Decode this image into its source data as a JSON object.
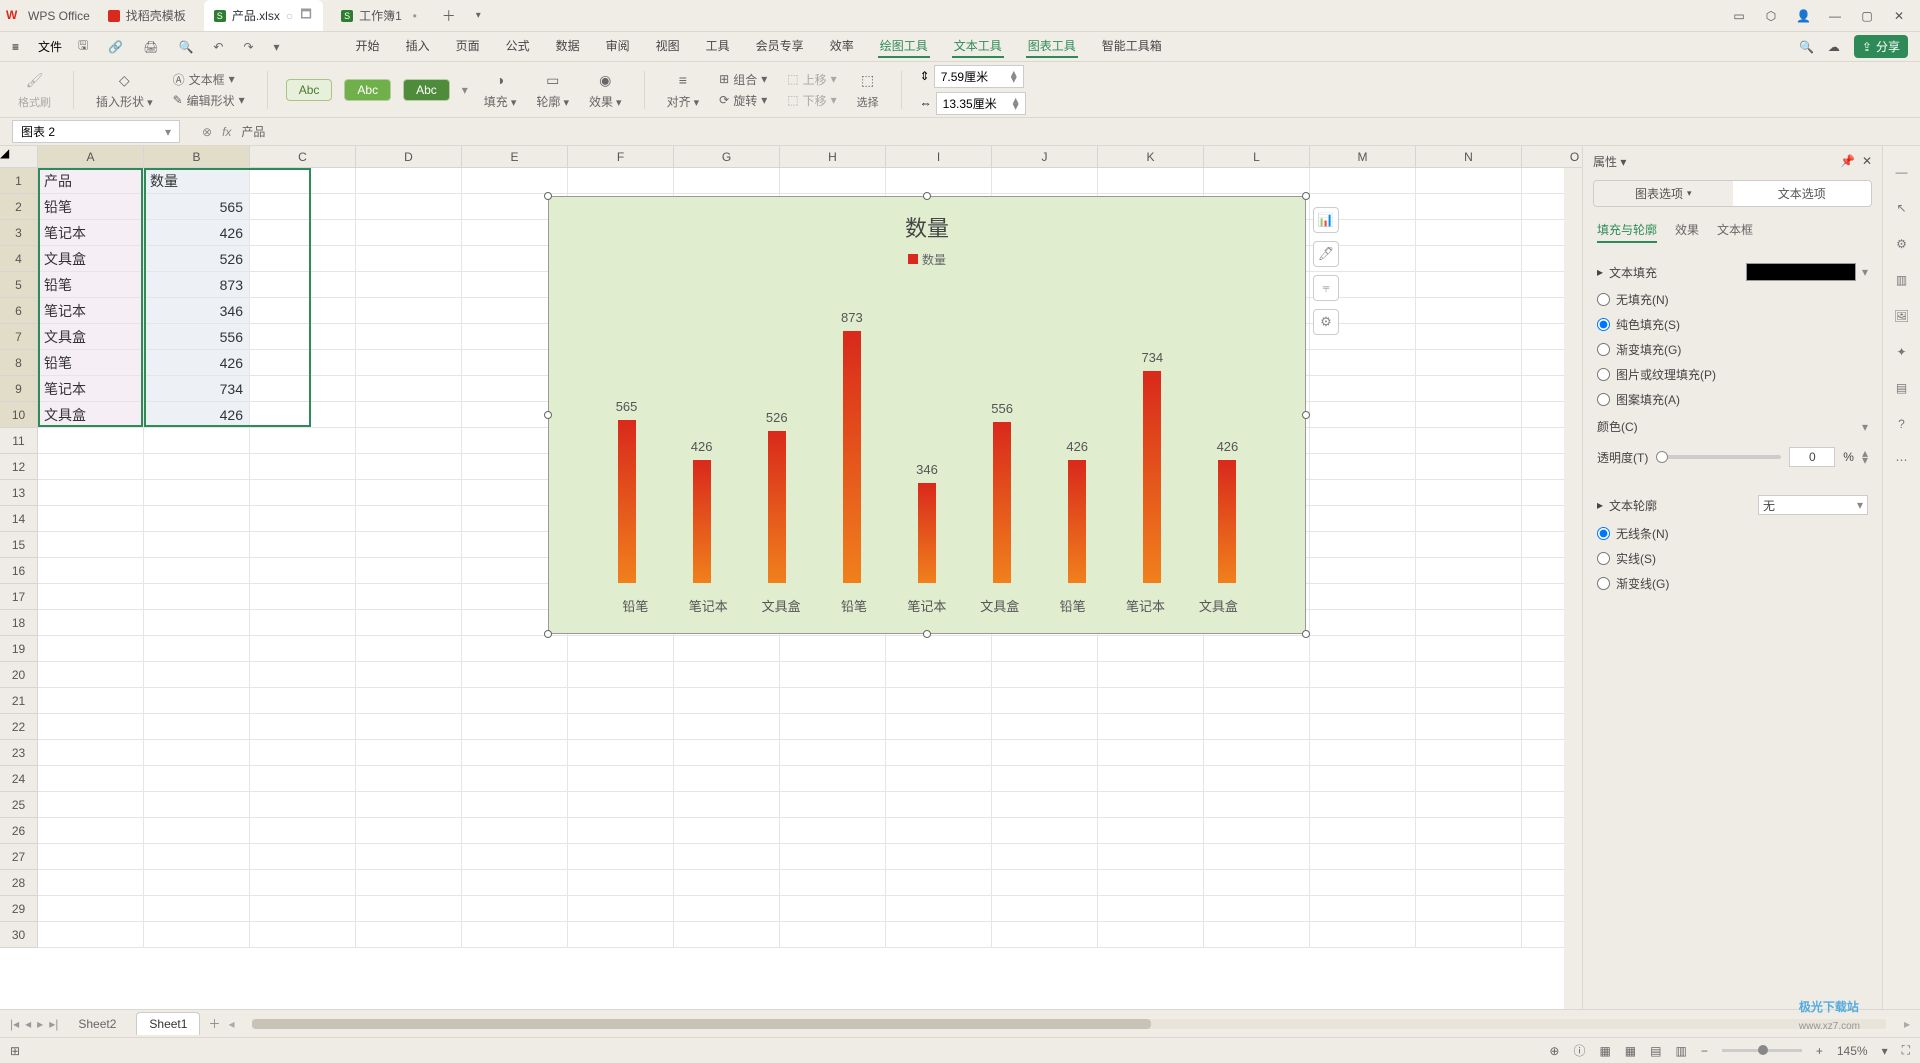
{
  "app_name": "WPS Office",
  "tabs": [
    {
      "icon_cls": "doc",
      "label": "找稻壳模板"
    },
    {
      "icon_cls": "xls",
      "label": "产品.xlsx",
      "active": true
    },
    {
      "icon_cls": "xls",
      "label": "工作簿1"
    }
  ],
  "file_menu": "文件",
  "main_menu": [
    "开始",
    "插入",
    "页面",
    "公式",
    "数据",
    "审阅",
    "视图",
    "工具",
    "会员专享",
    "效率",
    "绘图工具",
    "文本工具",
    "图表工具",
    "智能工具箱"
  ],
  "green_menus": [
    "绘图工具",
    "文本工具",
    "图表工具"
  ],
  "share_btn": "分享",
  "ribbon": {
    "format_painter": "格式刷",
    "insert_shape": "插入形状",
    "edit_shape": "编辑形状",
    "text_box": "文本框",
    "fill": "填充",
    "outline": "轮廓",
    "effects": "效果",
    "align": "对齐",
    "group": "组合",
    "move_up": "上移",
    "rotate": "旋转",
    "move_down": "下移",
    "select": "选择",
    "height": "7.59厘米",
    "width": "13.35厘米",
    "abc": "Abc"
  },
  "name_box": "图表 2",
  "fx_text": "产品",
  "columns": [
    "A",
    "B",
    "C",
    "D",
    "E",
    "F",
    "G",
    "H",
    "I",
    "J",
    "K",
    "L",
    "M",
    "N",
    "O"
  ],
  "sel_cols": [
    "A",
    "B"
  ],
  "sel_rows": 10,
  "table": {
    "headers": [
      "产品",
      "数量"
    ],
    "rows": [
      [
        "铅笔",
        565
      ],
      [
        "笔记本",
        426
      ],
      [
        "文具盒",
        526
      ],
      [
        "铅笔",
        873
      ],
      [
        "笔记本",
        346
      ],
      [
        "文具盒",
        556
      ],
      [
        "铅笔",
        426
      ],
      [
        "笔记本",
        734
      ],
      [
        "文具盒",
        426
      ]
    ]
  },
  "chart_data": {
    "type": "bar",
    "title": "数量",
    "legend": "数量",
    "categories": [
      "铅笔",
      "笔记本",
      "文具盒",
      "铅笔",
      "笔记本",
      "文具盒",
      "铅笔",
      "笔记本",
      "文具盒"
    ],
    "values": [
      565,
      426,
      526,
      873,
      346,
      556,
      426,
      734,
      426
    ],
    "ylim": [
      0,
      900
    ]
  },
  "panel": {
    "title": "属性",
    "tab1": "图表选项",
    "tab2": "文本选项",
    "subtabs": [
      "填充与轮廓",
      "效果",
      "文本框"
    ],
    "text_fill": "文本填充",
    "fill_options": [
      "无填充(N)",
      "纯色填充(S)",
      "渐变填充(G)",
      "图片或纹理填充(P)",
      "图案填充(A)"
    ],
    "fill_selected": "纯色填充(S)",
    "color_label": "颜色(C)",
    "opacity_label": "透明度(T)",
    "opacity_value": "0",
    "opacity_unit": "%",
    "text_outline": "文本轮廓",
    "outline_none": "无",
    "outline_options": [
      "无线条(N)",
      "实线(S)",
      "渐变线(G)"
    ],
    "outline_selected": "无线条(N)"
  },
  "sheets": [
    "Sheet2",
    "Sheet1"
  ],
  "active_sheet": "Sheet1",
  "status_zoom": "145%",
  "watermark": "极光下载站",
  "watermark_sub": "www.xz7.com"
}
